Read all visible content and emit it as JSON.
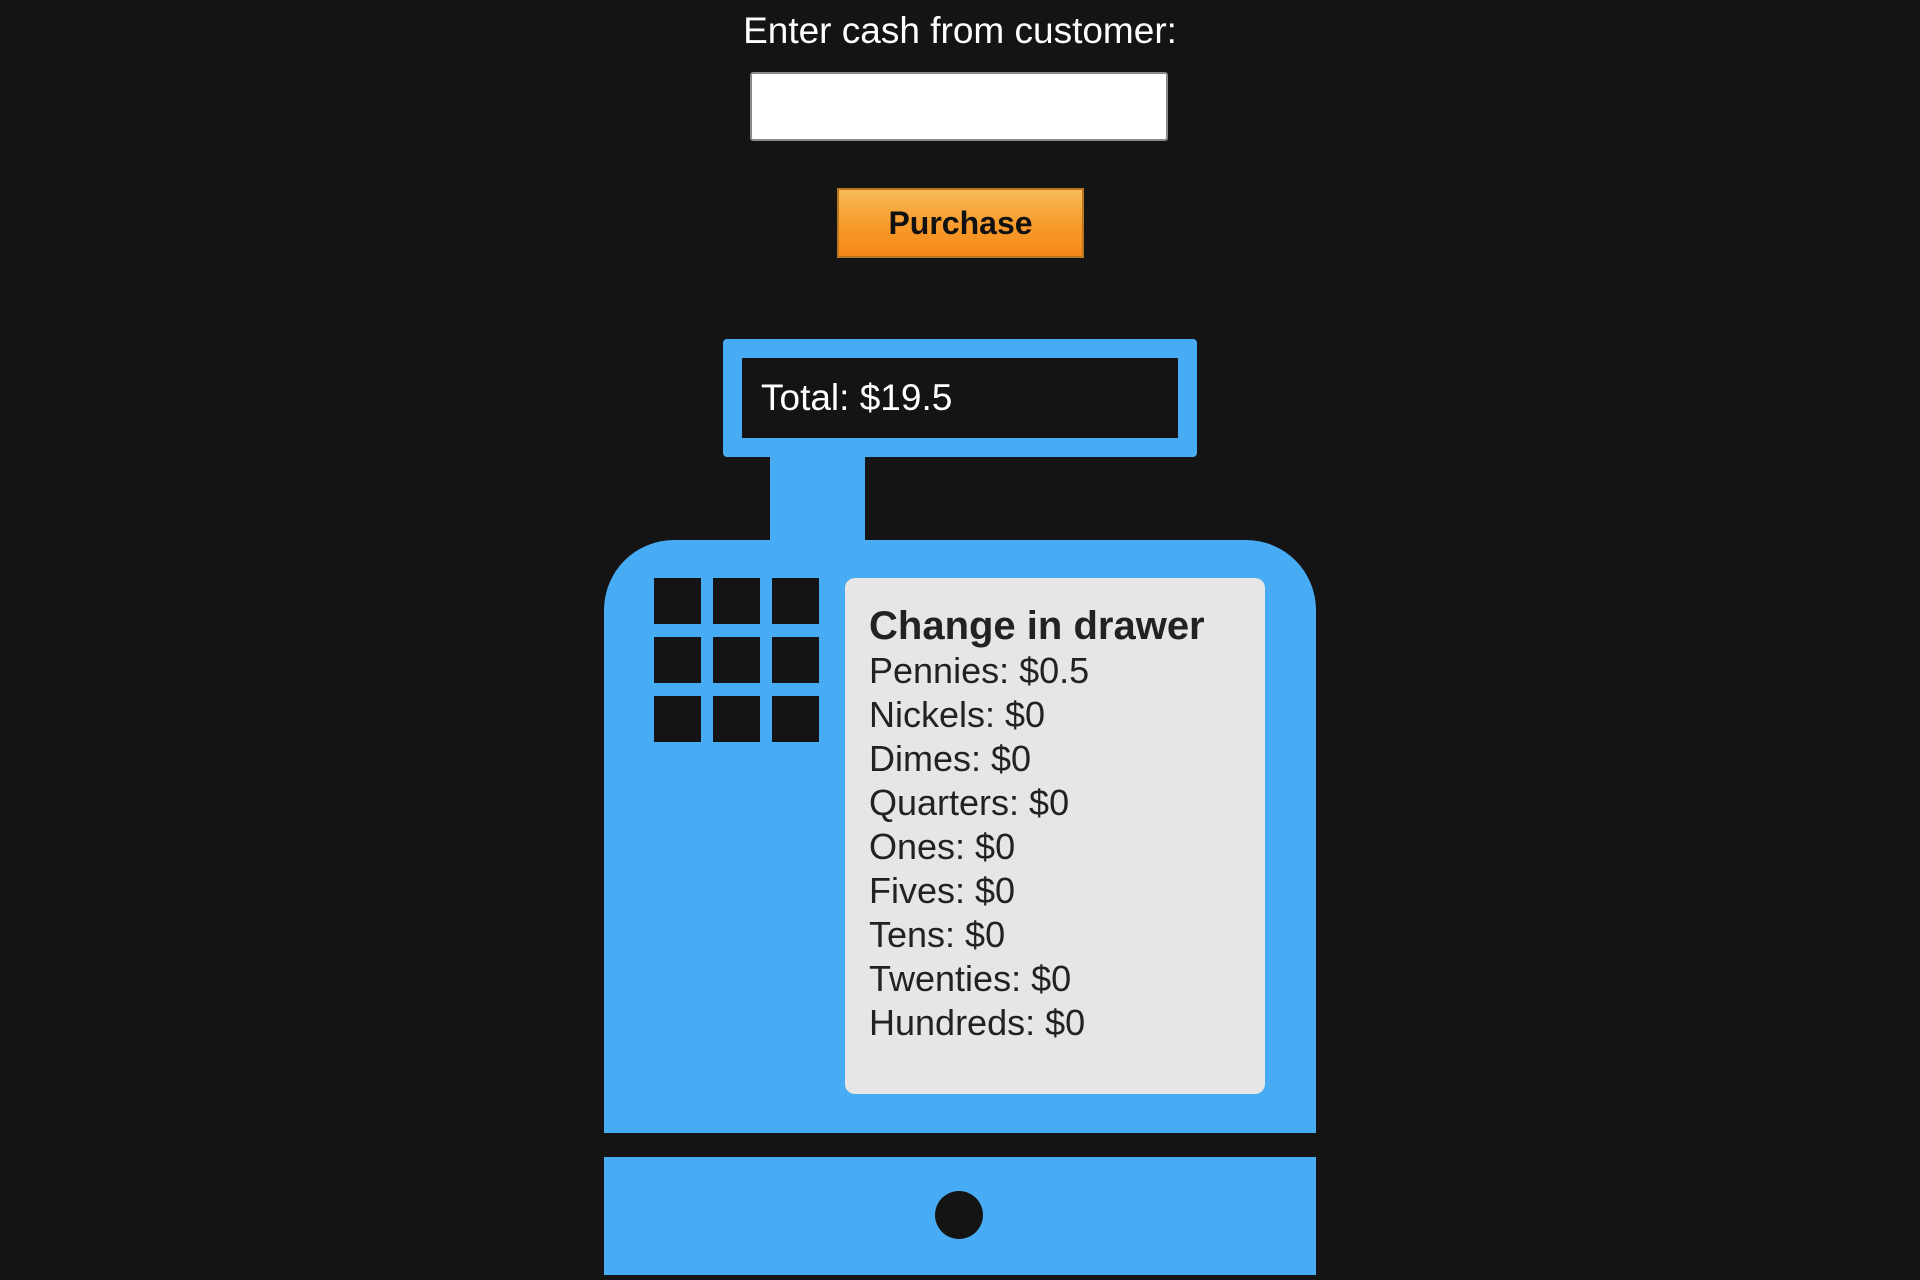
{
  "form": {
    "cash_label": "Enter cash from customer:",
    "cash_value": "",
    "cash_placeholder": "",
    "purchase_label": "Purchase"
  },
  "register": {
    "display_text": "Total: $19.5",
    "keypad_keys": 9,
    "drawer": {
      "title": "Change in drawer",
      "items": [
        "Pennies: $0.5",
        "Nickels: $0",
        "Dimes: $0",
        "Quarters: $0",
        "Ones: $0",
        "Fives: $0",
        "Tens: $0",
        "Twenties: $0",
        "Hundreds: $0"
      ]
    }
  },
  "colors": {
    "background": "#141414",
    "register_blue": "#47acf3",
    "button_orange": "#f79a2c",
    "drawer_card": "#e6e6e6"
  }
}
